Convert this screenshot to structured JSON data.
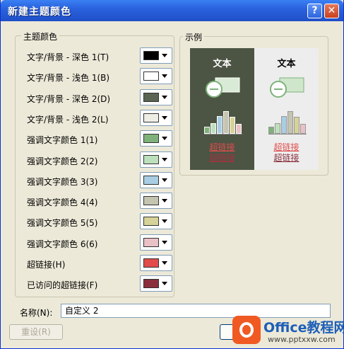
{
  "window": {
    "title": "新建主题颜色"
  },
  "theme_group": {
    "legend": "主题颜色",
    "rows": [
      {
        "label": "文字/背景 - 深色 1(T)",
        "color": "#000000"
      },
      {
        "label": "文字/背景 - 浅色 1(B)",
        "color": "#ffffff"
      },
      {
        "label": "文字/背景 - 深色 2(D)",
        "color": "#5b6452"
      },
      {
        "label": "文字/背景 - 浅色 2(L)",
        "color": "#eeeee5"
      },
      {
        "label": "强调文字颜色 1(1)",
        "color": "#7fb27a"
      },
      {
        "label": "强调文字颜色 2(2)",
        "color": "#bde0bc"
      },
      {
        "label": "强调文字颜色 3(3)",
        "color": "#a9cde2"
      },
      {
        "label": "强调文字颜色 4(4)",
        "color": "#c4c4b0"
      },
      {
        "label": "强调文字颜色 5(5)",
        "color": "#d7d298"
      },
      {
        "label": "强调文字颜色 6(6)",
        "color": "#eac1c6"
      },
      {
        "label": "超链接(H)",
        "color": "#e14b4b"
      },
      {
        "label": "已访问的超链接(F)",
        "color": "#8b2f3c"
      }
    ]
  },
  "sample_group": {
    "legend": "示例",
    "panels": [
      {
        "title": "文本",
        "link": "超链接",
        "visited": "超链接",
        "bg": "#4c5544",
        "fg": "#ffffff"
      },
      {
        "title": "文本",
        "link": "超链接",
        "visited": "超链接",
        "bg": "#ededed",
        "fg": "#000000"
      }
    ],
    "bars": [
      {
        "value": 30,
        "color": "#7fb27a"
      },
      {
        "value": 45,
        "color": "#bde0bc"
      },
      {
        "value": 75,
        "color": "#a9cde2"
      },
      {
        "value": 95,
        "color": "#c4c4b0"
      },
      {
        "value": 70,
        "color": "#d7d298"
      },
      {
        "value": 40,
        "color": "#eac1c6"
      }
    ]
  },
  "name_field": {
    "label": "名称(N):",
    "value": "自定义 2"
  },
  "buttons": {
    "reset": "重设(R)"
  },
  "watermark": {
    "brand": "Office教程网",
    "url": "www.pptxxw.com"
  }
}
